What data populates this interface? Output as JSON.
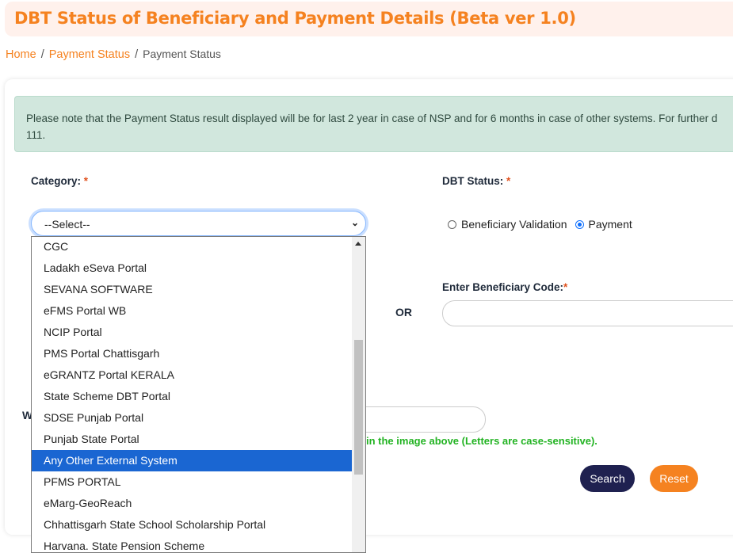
{
  "header": {
    "title": "DBT Status of Beneficiary and Payment Details (Beta ver 1.0)"
  },
  "breadcrumb": {
    "items": [
      "Home",
      "Payment Status",
      "Payment Status"
    ],
    "separator": "/"
  },
  "alert": {
    "text": "Please note that the Payment Status result displayed will be for last 2 year in case of NSP and for 6 months in case of other systems. For further d\n111."
  },
  "form": {
    "category_label": "Category:",
    "required_mark": "*",
    "category_select": {
      "selected": "--Select--",
      "options": [
        "CGC",
        "Ladakh eSeva Portal",
        "SEVANA SOFTWARE",
        "eFMS Portal WB",
        "NCIP Portal",
        "PMS Portal Chattisgarh",
        "eGRANTZ Portal KERALA",
        "State Scheme DBT Portal",
        "SDSE Punjab Portal",
        "Punjab State Portal",
        "Any Other External System",
        "PFMS PORTAL",
        "eMarg-GeoReach",
        "Chhattisgarh State School Scholarship Portal",
        "Harvana. State Pension Scheme"
      ],
      "highlighted": "Any Other External System"
    },
    "dbt_status_label": "DBT Status:",
    "dbt_status_options": [
      {
        "label": "Beneficiary Validation",
        "checked": false
      },
      {
        "label": "Payment",
        "checked": true
      }
    ],
    "or_label": "OR",
    "beneficiary_code_label": "Enter Beneficiary Code:",
    "beneficiary_code_value": "",
    "captcha_label_partial": "W",
    "captcha_value": "",
    "captcha_hint": "in the image above (Letters are case-sensitive).",
    "search_button": "Search",
    "reset_button": "Reset"
  },
  "colors": {
    "brand_orange": "#f58220",
    "search_navy": "#1f2150",
    "alert_green_bg": "#d1e7dd",
    "hint_green": "#22b322",
    "selected_option_blue": "#1a66d2"
  }
}
